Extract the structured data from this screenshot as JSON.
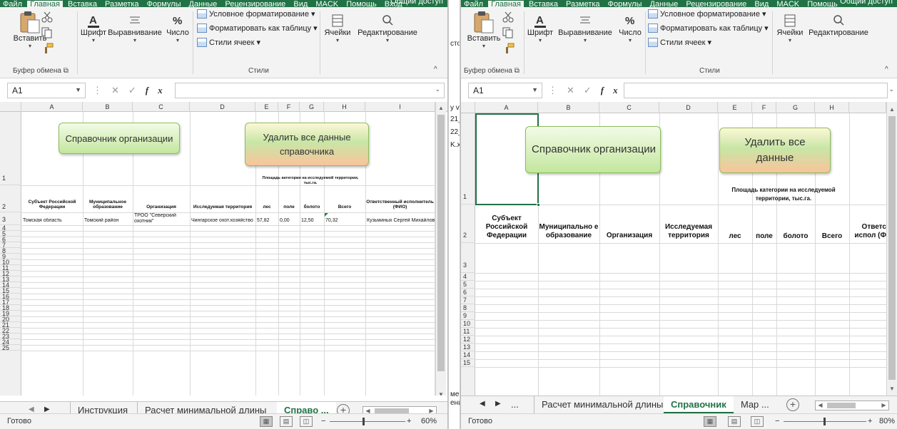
{
  "ribbon_tabs": [
    "Файл",
    "Главная",
    "Вставка",
    "Разметка",
    "Формулы",
    "Данные",
    "Рецензирование",
    "Вид",
    "MACK",
    "Помощь",
    "Вход"
  ],
  "active_ribbon_tab": "Главная",
  "share_label": "Общий доступ",
  "ribbon": {
    "paste": "Вставить",
    "font": "Шрифт",
    "alignment": "Выравнивание",
    "number": "Число",
    "conditional": "Условное форматирование",
    "format_table": "Форматировать как таблицу",
    "cell_styles": "Стили ячеек",
    "cells": "Ячейки",
    "editing": "Редактирование",
    "clipboard_group": "Буфер обмена",
    "styles_group": "Стили"
  },
  "name_box": "A1",
  "fx_label": "fx",
  "buttons": {
    "directory": "Справочник организации",
    "delete_all_left": "Удалить все данные справочника",
    "delete_all_right": "Удалить все данные"
  },
  "left": {
    "columns": [
      "A",
      "B",
      "C",
      "D",
      "E",
      "F",
      "G",
      "H",
      "I"
    ],
    "rows": [
      "1",
      "2",
      "3",
      "4",
      "5",
      "6",
      "7",
      "8",
      "9",
      "10",
      "11",
      "12",
      "13",
      "14",
      "15",
      "16",
      "17",
      "18",
      "19",
      "20",
      "21",
      "22",
      "23",
      "24",
      "25"
    ],
    "area_header": "Площадь категории на исследуемой территории, тыс.га.",
    "headers": [
      "Субъект Российской Федерации",
      "Муниципальное образование",
      "Организация",
      "Исследуемая территория",
      "лес",
      "поле",
      "болото",
      "Всего",
      "Ответственный исполнитель (ФИО)"
    ],
    "row3": [
      "Томская область",
      "Томский район",
      "ТРОО \"Северский охотник\"",
      "Чингарское охот.хозяйство",
      "57,82",
      "0,00",
      "12,50",
      "70,32",
      "Кузьминых Сергей Михайлович"
    ],
    "tabs": [
      "Инструкция",
      "Расчет минимальной длины",
      "Справо ..."
    ],
    "zoom": "60%"
  },
  "right": {
    "columns": [
      "A",
      "B",
      "C",
      "D",
      "E",
      "F",
      "G",
      "H"
    ],
    "rows": [
      "1",
      "2",
      "3",
      "4",
      "5",
      "6",
      "7",
      "8",
      "9",
      "10",
      "11",
      "12",
      "13",
      "14",
      "15"
    ],
    "area_header": "Площадь категории на исследуемой территории, тыс.га.",
    "headers": [
      "Субъект Российской Федерации",
      "Муниципально е образование",
      "Организация",
      "Исследуемая территория",
      "лес",
      "поле",
      "болото",
      "Всего",
      "Ответс испол (Ф"
    ],
    "tabs": [
      "...",
      "Расчет минимальной длины",
      "Справочник",
      "Map ..."
    ],
    "zoom": "80%"
  },
  "status": "Готово",
  "middle_fragments": [
    "сто",
    "у v.",
    "21_",
    "22_",
    "K.xl",
    "ме",
    "ени"
  ]
}
